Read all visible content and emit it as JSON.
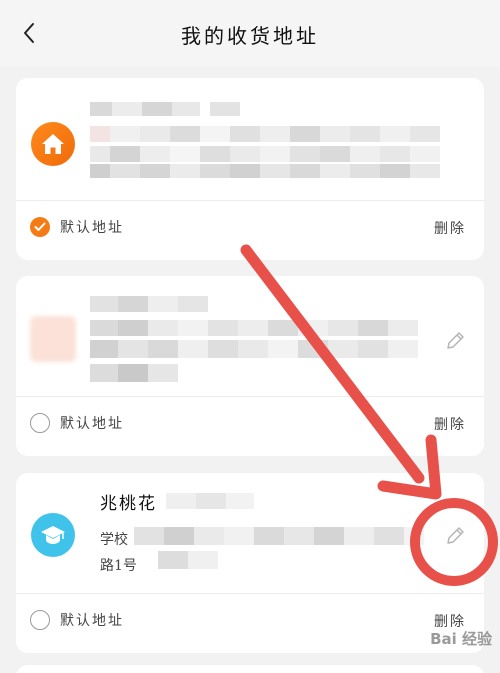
{
  "header": {
    "title": "我的收货地址"
  },
  "addresses": [
    {
      "icon": "home-icon",
      "icon_color": "#f57b14",
      "name": "",
      "address_line_1": "",
      "address_line_2": "",
      "default_label": "默认地址",
      "is_default": true,
      "delete_label": "删除"
    },
    {
      "icon": "",
      "name": "",
      "address_line_1": "",
      "address_line_2": "",
      "default_label": "默认地址",
      "is_default": false,
      "delete_label": "删除"
    },
    {
      "icon": "graduation-cap-icon",
      "icon_color": "#3fc3ea",
      "name": "兆桃花",
      "address_line_1": "学校",
      "address_line_2": "路1号",
      "default_label": "默认地址",
      "is_default": false,
      "delete_label": "删除"
    }
  ],
  "annotation": {
    "arrow_color": "#e8504a"
  },
  "watermark": {
    "text": "Bai 经验"
  }
}
